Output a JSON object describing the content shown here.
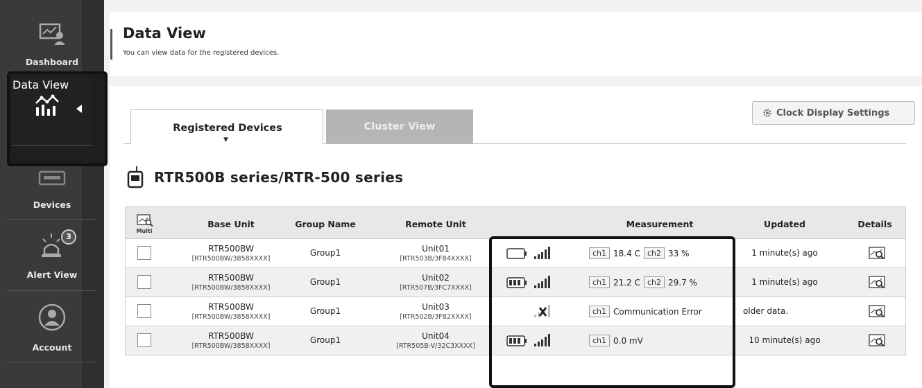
{
  "sidebar": {
    "items": [
      {
        "label": "Dashboard",
        "icon": "dashboard-monitor-icon"
      },
      {
        "label": "Data View",
        "icon": "data-view-chart-icon"
      },
      {
        "label": "Devices",
        "icon": "devices-icon"
      },
      {
        "label": "Alert View",
        "icon": "alert-siren-icon",
        "badge": "3"
      },
      {
        "label": "Account",
        "icon": "account-user-icon"
      }
    ]
  },
  "header": {
    "title": "Data View",
    "subtitle": "You can view data for the registered devices."
  },
  "tabs": [
    {
      "label": "Registered Devices",
      "caret": "▼",
      "active": true
    },
    {
      "label": "Cluster View",
      "active": false
    }
  ],
  "clock_button": {
    "label": "Clock Display Settings",
    "icon": "gear-icon"
  },
  "series_title": "RTR500B series/RTR-500 series",
  "table": {
    "multi_label": "Multi",
    "headers": {
      "base_unit": "Base Unit",
      "group_name": "Group Name",
      "remote_unit": "Remote Unit",
      "measurement": "Measurement",
      "updated": "Updated",
      "details": "Details"
    },
    "rows": [
      {
        "base": "RTR500BW",
        "base_sub": "[RTR500BW/3858XXXX]",
        "group": "Group1",
        "remote": "Unit01",
        "remote_sub": "[RTR503B/3F84XXXX]",
        "battery": "empty",
        "signal": "4-bars",
        "ch1_label": "ch1",
        "ch1": "18.4 C",
        "ch2_label": "ch2",
        "ch2": "33 %",
        "updated": "1 minute(s) ago"
      },
      {
        "base": "RTR500BW",
        "base_sub": "[RTR500BW/3858XXXX]",
        "group": "Group1",
        "remote": "Unit02",
        "remote_sub": "[RTR507B/3FC7XXXX]",
        "battery": "full",
        "signal": "4-bars",
        "ch1_label": "ch1",
        "ch1": "21.2 C",
        "ch2_label": "ch2",
        "ch2": "29.7 %",
        "updated": "1 minute(s) ago"
      },
      {
        "base": "RTR500BW",
        "base_sub": "[RTR500BW/3858XXXX]",
        "group": "Group1",
        "remote": "Unit03",
        "remote_sub": "[RTR502B/3F82XXXX]",
        "battery": "none",
        "signal": "no-signal",
        "ch1_label": "ch1",
        "ch1": "Communication Error",
        "ch2_label": "",
        "ch2": "",
        "updated": "older data."
      },
      {
        "base": "RTR500BW",
        "base_sub": "[RTR500BW/3858XXXX]",
        "group": "Group1",
        "remote": "Unit04",
        "remote_sub": "[RTR505B-V/32C3XXXX]",
        "battery": "full",
        "signal": "4-bars",
        "ch1_label": "ch1",
        "ch1": "0.0 mV",
        "ch2_label": "",
        "ch2": "",
        "updated": "10 minute(s) ago"
      }
    ]
  }
}
